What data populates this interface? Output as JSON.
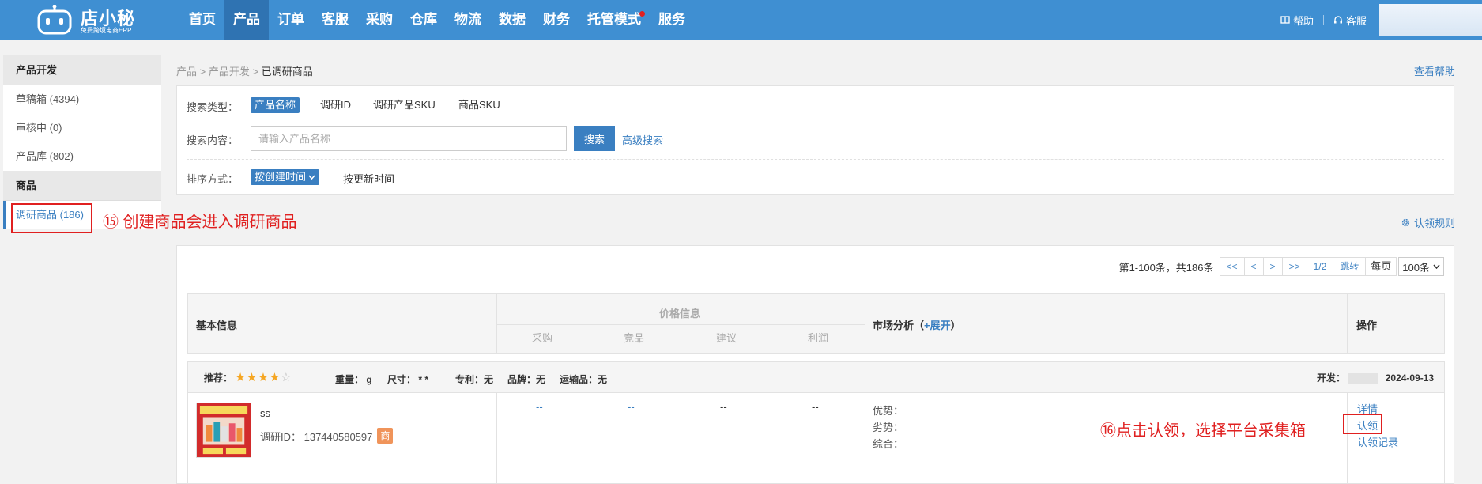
{
  "app": {
    "logo_text": "店小秘",
    "logo_sub": "免费跨境电商ERP",
    "nav": [
      "首页",
      "产品",
      "订单",
      "客服",
      "采购",
      "仓库",
      "物流",
      "数据",
      "财务",
      "托管模式",
      "服务"
    ],
    "active_nav": "产品",
    "help_label": "帮助",
    "service_label": "客服"
  },
  "sidebar": {
    "group1": "产品开发",
    "items1": [
      "草稿箱 (4394)",
      "审核中 (0)",
      "产品库 (802)"
    ],
    "group2": "商品",
    "items2": [
      "调研商品 (186)"
    ]
  },
  "annotations": {
    "a15": "⑮ 创建商品会进入调研商品",
    "a16": "⑯点击认领，选择平台采集箱"
  },
  "breadcrumb": {
    "parts": [
      "产品",
      "产品开发"
    ],
    "current": "已调研商品"
  },
  "help_link": "查看帮助",
  "search": {
    "type_label": "搜索类型：",
    "types": [
      "产品名称",
      "调研ID",
      "调研产品SKU",
      "商品SKU"
    ],
    "content_label": "搜索内容：",
    "placeholder": "请输入产品名称",
    "search_btn": "搜索",
    "advanced": "高级搜索",
    "sort_label": "排序方式：",
    "sort_active": "按创建时间",
    "sort_other": "按更新时间"
  },
  "rule_link": "认领规则",
  "pager": {
    "info": "第1-100条，共186条",
    "first": "<<",
    "prev": "<",
    "next": ">",
    "last": ">>",
    "page": "1/2",
    "jump": "跳转",
    "per_label": "每页",
    "per_value": "100条"
  },
  "table": {
    "basic": "基本信息",
    "price": "价格信息",
    "price_cols": [
      "采购",
      "竞品",
      "建议",
      "利润"
    ],
    "market": "市场分析（",
    "expand": "+展开",
    "market_close": "）",
    "ops": "操作"
  },
  "item": {
    "rec_label": "推荐：",
    "weight": "重量：  g",
    "size": "尺寸：  * *",
    "patent": "专利：无",
    "brand": "品牌：无",
    "transport": "运输品：无",
    "dev_label": "开发：",
    "date": "2024-09-13",
    "rating": 4,
    "name": "ss",
    "research_id": "调研ID：  137440580597",
    "badge": "商",
    "prices": [
      "--",
      "--",
      "--",
      "--"
    ],
    "market": [
      "优势：",
      "劣势：",
      "综合："
    ],
    "ops": [
      "详情",
      "认领",
      "认领记录"
    ]
  }
}
